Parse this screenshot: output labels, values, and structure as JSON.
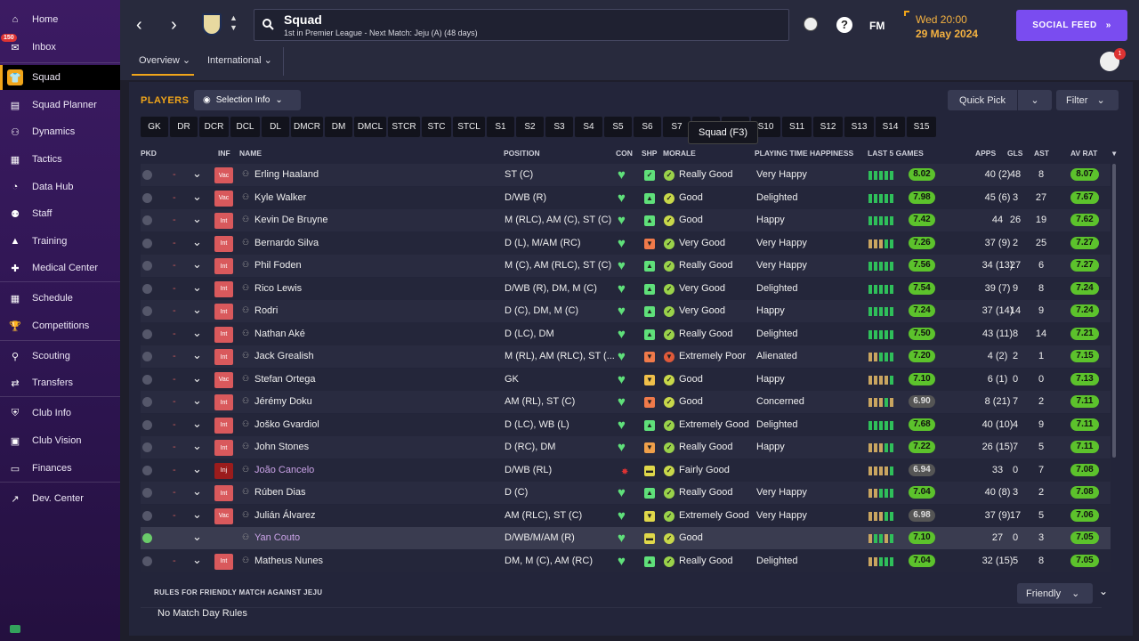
{
  "sidebar": {
    "inbox_badge": "150",
    "items": [
      {
        "key": "home",
        "label": "Home",
        "icon": "home-icon",
        "glyph": "⌂"
      },
      {
        "key": "inbox",
        "label": "Inbox",
        "icon": "inbox-icon",
        "glyph": "✉"
      },
      {
        "key": "squad",
        "label": "Squad",
        "icon": "shirt-icon",
        "glyph": "👕"
      },
      {
        "key": "squad-planner",
        "label": "Squad Planner",
        "icon": "clipboard-icon",
        "glyph": "▤"
      },
      {
        "key": "dynamics",
        "label": "Dynamics",
        "icon": "people-icon",
        "glyph": "⚇"
      },
      {
        "key": "tactics",
        "label": "Tactics",
        "icon": "tactics-board-icon",
        "glyph": "▦"
      },
      {
        "key": "data-hub",
        "label": "Data Hub",
        "icon": "data-hub-icon",
        "glyph": "◔"
      },
      {
        "key": "staff",
        "label": "Staff",
        "icon": "staff-icon",
        "glyph": "⚉"
      },
      {
        "key": "training",
        "label": "Training",
        "icon": "training-cone-icon",
        "glyph": "▲"
      },
      {
        "key": "medical-center",
        "label": "Medical Center",
        "icon": "medical-kit-icon",
        "glyph": "✚"
      },
      {
        "key": "schedule",
        "label": "Schedule",
        "icon": "calendar-icon",
        "glyph": "▦"
      },
      {
        "key": "competitions",
        "label": "Competitions",
        "icon": "trophy-icon",
        "glyph": "🏆"
      },
      {
        "key": "scouting",
        "label": "Scouting",
        "icon": "magnifier-icon",
        "glyph": "⚲"
      },
      {
        "key": "transfers",
        "label": "Transfers",
        "icon": "transfer-arrows-icon",
        "glyph": "⇄"
      },
      {
        "key": "club-info",
        "label": "Club Info",
        "icon": "shield-icon",
        "glyph": "⛨"
      },
      {
        "key": "club-vision",
        "label": "Club Vision",
        "icon": "briefcase-icon",
        "glyph": "▣"
      },
      {
        "key": "finances",
        "label": "Finances",
        "icon": "money-icon",
        "glyph": "▭"
      },
      {
        "key": "dev-center",
        "label": "Dev. Center",
        "icon": "trend-icon",
        "glyph": "↗"
      }
    ]
  },
  "header": {
    "title": "Squad",
    "subtitle": "1st in Premier League - Next Match: Jeju (A) (48 days)",
    "fm_label": "FM",
    "time": "Wed 20:00",
    "date": "29 May 2024",
    "social_feed": "SOCIAL FEED",
    "people_badge": "1",
    "tabs": [
      "Overview",
      "International"
    ]
  },
  "players_heading": "PLAYERS",
  "selection_info": "Selection Info",
  "quick_pick": "Quick Pick",
  "filter": "Filter",
  "tooltip": "Squad (F3)",
  "position_chips": [
    "GK",
    "DR",
    "DCR",
    "DCL",
    "DL",
    "DMCR",
    "DM",
    "DMCL",
    "STCR",
    "STC",
    "STCL",
    "S1",
    "S2",
    "S3",
    "S4",
    "S5",
    "S6",
    "S7",
    "S8",
    "S9",
    "S10",
    "S11",
    "S12",
    "S13",
    "S14",
    "S15"
  ],
  "columns": {
    "pkd": "PKD",
    "inf": "INF",
    "name": "NAME",
    "position": "POSITION",
    "con": "CON",
    "shp": "SHP",
    "morale": "MORALE",
    "pth": "PLAYING TIME HAPPINESS",
    "last5": "LAST 5 GAMES",
    "apps": "APPS",
    "gls": "GLS",
    "ast": "AST",
    "avrat": "AV RAT"
  },
  "colors": {
    "accent": "#f0a51a",
    "social": "#7a4cf0",
    "good": "#5cc22c",
    "neutral": "#555555"
  },
  "players": [
    {
      "pkd": false,
      "dash": "-",
      "inf": "Vac",
      "name": "Erling Haaland",
      "pos": "ST (C)",
      "shp": "✓",
      "shp_c": "#5fe07a",
      "mor": "✓",
      "mor_c": "#9ad24a",
      "morale": "Really Good",
      "pth": "Very Happy",
      "form": [
        "#2fbf5a",
        "#2fbf5a",
        "#2fbf5a",
        "#2fbf5a",
        "#2fbf5a"
      ],
      "last5": "8.02",
      "l5c": "#5cc22c",
      "apps": "40 (2)",
      "gls": "48",
      "ast": "8",
      "avrat": "8.07",
      "arc": "#5cc22c"
    },
    {
      "pkd": false,
      "dash": "-",
      "inf": "Vac",
      "name": "Kyle Walker",
      "pos": "D/WB (R)",
      "shp": "▲",
      "shp_c": "#5fe07a",
      "mor": "✓",
      "mor_c": "#c8d84a",
      "morale": "Good",
      "pth": "Delighted",
      "form": [
        "#2fbf5a",
        "#2fbf5a",
        "#2fbf5a",
        "#2fbf5a",
        "#2fbf5a"
      ],
      "last5": "7.98",
      "l5c": "#5cc22c",
      "apps": "45 (6)",
      "gls": "3",
      "ast": "27",
      "avrat": "7.67",
      "arc": "#5cc22c"
    },
    {
      "pkd": false,
      "dash": "-",
      "inf": "Int",
      "name": "Kevin De Bruyne",
      "pos": "M (RLC), AM (C), ST (C)",
      "shp": "▲",
      "shp_c": "#5fe07a",
      "mor": "✓",
      "mor_c": "#c8d84a",
      "morale": "Good",
      "pth": "Happy",
      "form": [
        "#2fbf5a",
        "#2fbf5a",
        "#2fbf5a",
        "#2fbf5a",
        "#2fbf5a"
      ],
      "last5": "7.42",
      "l5c": "#5cc22c",
      "apps": "44",
      "gls": "26",
      "ast": "19",
      "avrat": "7.62",
      "arc": "#5cc22c"
    },
    {
      "pkd": false,
      "dash": "-",
      "inf": "Int",
      "name": "Bernardo Silva",
      "pos": "D (L), M/AM (RC)",
      "shp": "▼",
      "shp_c": "#f07a4a",
      "mor": "✓",
      "mor_c": "#9ad24a",
      "morale": "Very Good",
      "pth": "Very Happy",
      "form": [
        "#c9a560",
        "#c9a560",
        "#c9a560",
        "#2fbf5a",
        "#2fbf5a"
      ],
      "last5": "7.26",
      "l5c": "#5cc22c",
      "apps": "37 (9)",
      "gls": "2",
      "ast": "25",
      "avrat": "7.27",
      "arc": "#5cc22c"
    },
    {
      "pkd": false,
      "dash": "-",
      "inf": "Int",
      "name": "Phil Foden",
      "pos": "M (C), AM (RLC), ST (C)",
      "shp": "▲",
      "shp_c": "#5fe07a",
      "mor": "✓",
      "mor_c": "#9ad24a",
      "morale": "Really Good",
      "pth": "Very Happy",
      "form": [
        "#2fbf5a",
        "#2fbf5a",
        "#2fbf5a",
        "#2fbf5a",
        "#2fbf5a"
      ],
      "last5": "7.56",
      "l5c": "#5cc22c",
      "apps": "34 (13)",
      "gls": "27",
      "ast": "6",
      "avrat": "7.27",
      "arc": "#5cc22c"
    },
    {
      "pkd": false,
      "dash": "-",
      "inf": "Int",
      "name": "Rico Lewis",
      "pos": "D/WB (R), DM, M (C)",
      "shp": "▲",
      "shp_c": "#5fe07a",
      "mor": "✓",
      "mor_c": "#9ad24a",
      "morale": "Very Good",
      "pth": "Delighted",
      "form": [
        "#2fbf5a",
        "#2fbf5a",
        "#2fbf5a",
        "#2fbf5a",
        "#2fbf5a"
      ],
      "last5": "7.54",
      "l5c": "#5cc22c",
      "apps": "39 (7)",
      "gls": "9",
      "ast": "8",
      "avrat": "7.24",
      "arc": "#5cc22c"
    },
    {
      "pkd": false,
      "dash": "-",
      "inf": "Int",
      "name": "Rodri",
      "pos": "D (C), DM, M (C)",
      "shp": "▲",
      "shp_c": "#5fe07a",
      "mor": "✓",
      "mor_c": "#9ad24a",
      "morale": "Very Good",
      "pth": "Happy",
      "form": [
        "#2fbf5a",
        "#2fbf5a",
        "#2fbf5a",
        "#2fbf5a",
        "#2fbf5a"
      ],
      "last5": "7.24",
      "l5c": "#5cc22c",
      "apps": "37 (14)",
      "gls": "14",
      "ast": "9",
      "avrat": "7.24",
      "arc": "#5cc22c"
    },
    {
      "pkd": false,
      "dash": "-",
      "inf": "Int",
      "name": "Nathan Aké",
      "pos": "D (LC), DM",
      "shp": "▲",
      "shp_c": "#5fe07a",
      "mor": "✓",
      "mor_c": "#9ad24a",
      "morale": "Really Good",
      "pth": "Delighted",
      "form": [
        "#2fbf5a",
        "#2fbf5a",
        "#2fbf5a",
        "#2fbf5a",
        "#2fbf5a"
      ],
      "last5": "7.50",
      "l5c": "#5cc22c",
      "apps": "43 (11)",
      "gls": "8",
      "ast": "14",
      "avrat": "7.21",
      "arc": "#5cc22c"
    },
    {
      "pkd": false,
      "dash": "-",
      "inf": "Int",
      "name": "Jack Grealish",
      "pos": "M (RL), AM (RLC), ST (...",
      "shp": "▼",
      "shp_c": "#f07a4a",
      "mor": "▼",
      "mor_c": "#e05a3a",
      "morale": "Extremely Poor",
      "pth": "Alienated",
      "form": [
        "#c9a560",
        "#c9a560",
        "#2fbf5a",
        "#2fbf5a",
        "#2fbf5a"
      ],
      "last5": "7.20",
      "l5c": "#5cc22c",
      "apps": "4 (2)",
      "gls": "2",
      "ast": "1",
      "avrat": "7.15",
      "arc": "#5cc22c"
    },
    {
      "pkd": false,
      "dash": "-",
      "inf": "Vac",
      "name": "Stefan Ortega",
      "pos": "GK",
      "shp": "▼",
      "shp_c": "#f0c04a",
      "mor": "✓",
      "mor_c": "#c8d84a",
      "morale": "Good",
      "pth": "Happy",
      "form": [
        "#c9a560",
        "#c9a560",
        "#c9a560",
        "#c9a560",
        "#2fbf5a"
      ],
      "last5": "7.10",
      "l5c": "#5cc22c",
      "apps": "6 (1)",
      "gls": "0",
      "ast": "0",
      "avrat": "7.13",
      "arc": "#5cc22c"
    },
    {
      "pkd": false,
      "dash": "-",
      "inf": "Int",
      "name": "Jérémy Doku",
      "pos": "AM (RL), ST (C)",
      "shp": "▼",
      "shp_c": "#f07a4a",
      "mor": "✓",
      "mor_c": "#c8d84a",
      "morale": "Good",
      "pth": "Concerned",
      "form": [
        "#c9a560",
        "#c9a560",
        "#c9a560",
        "#2fbf5a",
        "#c9a560"
      ],
      "last5": "6.90",
      "l5c": "#555555",
      "apps": "8 (21)",
      "gls": "7",
      "ast": "2",
      "avrat": "7.11",
      "arc": "#5cc22c"
    },
    {
      "pkd": false,
      "dash": "-",
      "inf": "Int",
      "name": "Joško Gvardiol",
      "pos": "D (LC), WB (L)",
      "shp": "▲",
      "shp_c": "#5fe07a",
      "mor": "✓",
      "mor_c": "#9ad24a",
      "morale": "Extremely Good",
      "pth": "Delighted",
      "form": [
        "#2fbf5a",
        "#2fbf5a",
        "#2fbf5a",
        "#2fbf5a",
        "#2fbf5a"
      ],
      "last5": "7.68",
      "l5c": "#5cc22c",
      "apps": "40 (10)",
      "gls": "4",
      "ast": "9",
      "avrat": "7.11",
      "arc": "#5cc22c"
    },
    {
      "pkd": false,
      "dash": "-",
      "inf": "Int",
      "name": "John Stones",
      "pos": "D (RC), DM",
      "shp": "▼",
      "shp_c": "#f0a04a",
      "mor": "✓",
      "mor_c": "#9ad24a",
      "morale": "Really Good",
      "pth": "Happy",
      "form": [
        "#c9a560",
        "#c9a560",
        "#c9a560",
        "#2fbf5a",
        "#2fbf5a"
      ],
      "last5": "7.22",
      "l5c": "#5cc22c",
      "apps": "26 (15)",
      "gls": "7",
      "ast": "5",
      "avrat": "7.11",
      "arc": "#5cc22c"
    },
    {
      "pkd": false,
      "dash": "-",
      "inf": "Inj",
      "name": "João Cancelo",
      "pos": "D/WB (RL)",
      "shp": "▬",
      "shp_c": "#e0d84a",
      "mor": "✓",
      "mor_c": "#c8d84a",
      "morale": "Fairly Good",
      "pth": "",
      "form": [
        "#c9a560",
        "#c9a560",
        "#c9a560",
        "#c9a560",
        "#2fbf5a"
      ],
      "last5": "6.94",
      "l5c": "#555555",
      "apps": "33",
      "gls": "0",
      "ast": "7",
      "avrat": "7.08",
      "arc": "#5cc22c"
    },
    {
      "pkd": false,
      "dash": "-",
      "inf": "Int",
      "name": "Rúben Dias",
      "pos": "D (C)",
      "shp": "▲",
      "shp_c": "#5fe07a",
      "mor": "✓",
      "mor_c": "#9ad24a",
      "morale": "Really Good",
      "pth": "Very Happy",
      "form": [
        "#c9a560",
        "#c9a560",
        "#2fbf5a",
        "#2fbf5a",
        "#2fbf5a"
      ],
      "last5": "7.04",
      "l5c": "#5cc22c",
      "apps": "40 (8)",
      "gls": "3",
      "ast": "2",
      "avrat": "7.08",
      "arc": "#5cc22c"
    },
    {
      "pkd": false,
      "dash": "-",
      "inf": "Vac",
      "name": "Julián Álvarez",
      "pos": "AM (RLC), ST (C)",
      "shp": "▼",
      "shp_c": "#e0d84a",
      "mor": "✓",
      "mor_c": "#9ad24a",
      "morale": "Extremely Good",
      "pth": "Very Happy",
      "form": [
        "#c9a560",
        "#c9a560",
        "#c9a560",
        "#2fbf5a",
        "#2fbf5a"
      ],
      "last5": "6.98",
      "l5c": "#555555",
      "apps": "37 (9)",
      "gls": "17",
      "ast": "5",
      "avrat": "7.06",
      "arc": "#5cc22c"
    },
    {
      "pkd": true,
      "dash": "",
      "inf": "",
      "name": "Yan Couto",
      "pos": "D/WB/M/AM (R)",
      "shp": "▬",
      "shp_c": "#e0d84a",
      "mor": "✓",
      "mor_c": "#c8d84a",
      "morale": "Good",
      "pth": "",
      "form": [
        "#c9a560",
        "#2fbf5a",
        "#2fbf5a",
        "#c9a560",
        "#2fbf5a"
      ],
      "last5": "7.10",
      "l5c": "#5cc22c",
      "apps": "27",
      "gls": "0",
      "ast": "3",
      "avrat": "7.05",
      "arc": "#5cc22c"
    },
    {
      "pkd": false,
      "dash": "-",
      "inf": "Int",
      "name": "Matheus Nunes",
      "pos": "DM, M (C), AM (RC)",
      "shp": "▲",
      "shp_c": "#5fe07a",
      "mor": "✓",
      "mor_c": "#9ad24a",
      "morale": "Really Good",
      "pth": "Delighted",
      "form": [
        "#c9a560",
        "#c9a560",
        "#2fbf5a",
        "#2fbf5a",
        "#2fbf5a"
      ],
      "last5": "7.04",
      "l5c": "#5cc22c",
      "apps": "32 (15)",
      "gls": "5",
      "ast": "8",
      "avrat": "7.05",
      "arc": "#5cc22c"
    }
  ],
  "rules": {
    "title": "RULES FOR FRIENDLY MATCH AGAINST JEJU",
    "text": "No Match Day Rules",
    "dropdown": "Friendly"
  }
}
